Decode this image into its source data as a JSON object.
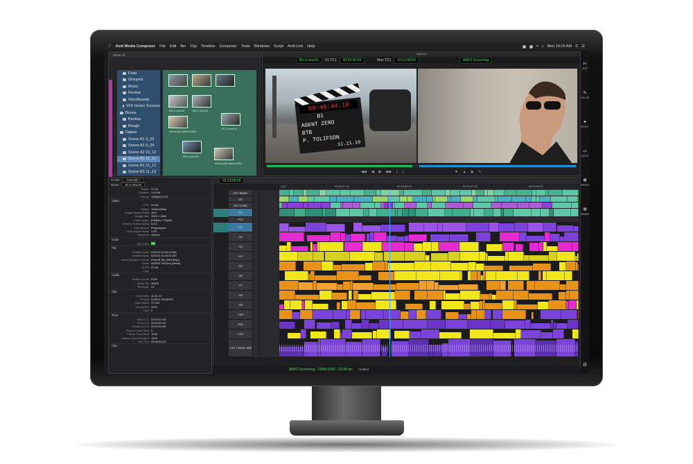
{
  "menubar": {
    "app": "Avid Media Composer",
    "items": [
      "File",
      "Edit",
      "Bin",
      "Clip",
      "Timeline",
      "Composer",
      "Tools",
      "Windows",
      "Script",
      "Avid Link",
      "Help"
    ],
    "clock": "Mon 10:15 AM"
  },
  "bin": {
    "show_all": "Show All",
    "folders": [
      {
        "label": "Final",
        "selected": false
      },
      {
        "label": "Grouped",
        "selected": false
      },
      {
        "label": "Music",
        "selected": false
      },
      {
        "label": "Review",
        "selected": false
      },
      {
        "label": "StoryBoards",
        "selected": false
      },
      {
        "label": "VFX Green Screens",
        "selected": false
      },
      {
        "label": "Bonus",
        "selected": false
      },
      {
        "label": "Backup",
        "selected": false
      },
      {
        "label": "Rough",
        "selected": false
      },
      {
        "label": "Dailies",
        "selected": false
      },
      {
        "label": "Scene A1 9_23",
        "selected": false
      },
      {
        "label": "Scene A1 9_24",
        "selected": false
      },
      {
        "label": "Scene A2 10_12",
        "selected": false
      },
      {
        "label": "Scene B1 11_11",
        "selected": true
      },
      {
        "label": "Scene B1 11_12",
        "selected": false
      },
      {
        "label": "Scene B1 11_13",
        "selected": false
      }
    ],
    "clips": [
      "B6-2.new.03",
      "B6-2.new.05",
      "delivery60-take1843D...",
      "B1-2.new.01",
      "B6-4.new.03",
      "delivery60-take1843D..."
    ]
  },
  "viewer": {
    "title": "MilliZero",
    "source_clip": "B1-2.new.01",
    "track": "V1 TC1",
    "source_tc": "00:23:47:08",
    "mas_label": "Mas TC1",
    "record_tc": "02:13:58:09",
    "record_title": "AMX2 Screening",
    "slate_tc": "09:46:44:10",
    "slate_scene": "B1",
    "slate_title": "AGENT ZERO",
    "slate_btb": "BTB",
    "slate_name": "P. TOLIFSON",
    "slate_date": "11.11.10"
  },
  "tools": [
    {
      "icon": "edit-icon",
      "label": "EDIT"
    },
    {
      "icon": "color-icon",
      "label": "COLOR"
    },
    {
      "icon": "effects-icon",
      "label": "EFFECTS"
    },
    {
      "icon": "audio-icon",
      "label": "AUDIO"
    },
    {
      "icon": "mpview-icon",
      "label": "MPVIEW"
    },
    {
      "icon": "newsr-icon",
      "label": "NEWSR"
    }
  ],
  "inspector": {
    "profile_label": "Profile:",
    "profile_value": "Override 7",
    "name_label": "Name",
    "name_value": "B1-2.new.01",
    "tracks": [
      [
        "Tracks",
        "V1 A1"
      ],
      [
        "Duration",
        "1:04:06"
      ],
      [
        "Format",
        "1080p/23.976"
      ]
    ],
    "sections": [
      {
        "title": "Video",
        "rows": [
          [
            "FPS",
            "23.98"
          ],
          [
            "Raster",
            "1920x1080p"
          ],
          [
            "Image Aspect Ratio",
            "16:9"
          ],
          [
            "Image Size",
            "1920 x 1080"
          ],
          [
            "Color Space",
            "[HD]Rec.709(45)"
          ],
          [
            "Chroma Subsampling",
            "4:2:2"
          ],
          [
            "Field Motion",
            "Progressive"
          ],
          [
            "Pixel Aspect Ratio",
            "1.00"
          ],
          [
            "Reformat",
            "Stretch"
          ]
        ]
      },
      {
        "title": "Color",
        "rows": [
          [
            "Clip Color",
            ""
          ]
        ]
      },
      {
        "title": "File",
        "rows": [
          [
            "Creation Date",
            "5/20/19 11:04:22 AM"
          ],
          [
            "Modified Date",
            "5/20/19 11:04:22 AM"
          ],
          [
            "Video Wrapper Format",
            "DNxHR SD (HD1080p)"
          ],
          [
            "Drive",
            "AGENT MXZero [Nexis]"
          ],
          [
            "CFPS",
            "23.98"
          ],
          [
            "Lock",
            ""
          ]
        ]
      },
      {
        "title": "Audio",
        "rows": [
          [
            "Audio Format",
            "PCM"
          ],
          [
            "Audio SR",
            "48000"
          ],
          [
            "Bit Depth",
            "24"
          ]
        ]
      },
      {
        "title": "Clip",
        "rows": [
          [
            "Shoot Date",
            "11-11-10"
          ],
          [
            "Project",
            "AGENT MXZERO"
          ],
          [
            "Tape Name",
            "VT103"
          ],
          [
            "Sound Roll",
            "MOS"
          ],
          [
            "Take",
            "2"
          ]
        ]
      },
      {
        "title": "Time",
        "rows": [
          [
            "Start (TC)",
            "03:23:47:08"
          ],
          [
            "End (TC)",
            "03:24:51:13"
          ],
          [
            "Duration (TC)",
            "00:01:04:06"
          ],
          [
            "Frame Count Start",
            "0"
          ],
          [
            "Frame Count End",
            "1539"
          ],
          [
            "Frame Count Duration",
            "1540"
          ],
          [
            "Aux TC1",
            "09:46:44:10"
          ]
        ]
      },
      {
        "title": "CDL",
        "rows": []
      }
    ]
  },
  "timeline": {
    "tc": "02:13:58:09",
    "ruler": [
      "1:12",
      "02:13:17:12",
      "02:13:50:12",
      "02:14:17:12",
      "02:14:50:12"
    ],
    "tracks": [
      "V4 / Music",
      "V3",
      "V2 / Color",
      "V1",
      "TC1",
      "A1",
      "A2",
      "A3",
      "A4",
      "A5",
      "A6",
      "A7",
      "A8",
      "A9",
      "A10",
      "A11",
      "A12",
      "A13 / Music Mix"
    ]
  },
  "status": {
    "title": "AMX2 Screening - 2048x1080 - 23.98 fps",
    "zoom": "Untitled"
  },
  "colors": {
    "video": "#5fc6a8",
    "audio_purple": "#7b43d9",
    "audio_yellow": "#f0e61a",
    "audio_orange": "#e8921a",
    "audio_magenta": "#e52ad2",
    "accent_green": "#3fdc5a"
  }
}
